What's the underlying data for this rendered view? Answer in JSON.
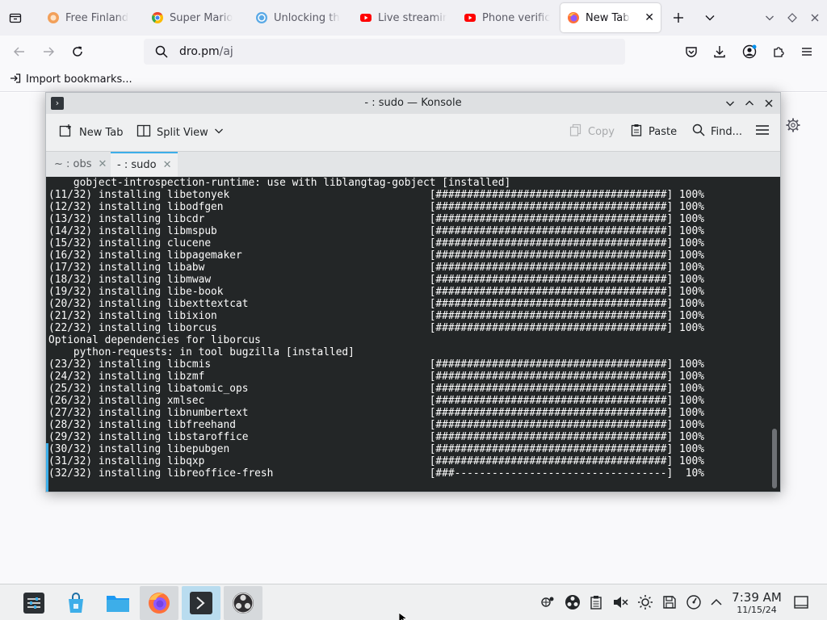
{
  "browser": {
    "tabs": [
      {
        "label": "Free Finland",
        "favicon": "globe-orange-icon",
        "color": "#f2a05a"
      },
      {
        "label": "Super Mario",
        "favicon": "chrome-like-icon",
        "color": "#ea4335"
      },
      {
        "label": "Unlocking th",
        "favicon": "blue-circle-icon",
        "color": "#5aa9e6"
      },
      {
        "label": "Live streamir",
        "favicon": "youtube-icon",
        "color": "#ff0000"
      },
      {
        "label": "Phone verific",
        "favicon": "youtube-icon",
        "color": "#ff0000"
      },
      {
        "label": "New Tab",
        "favicon": "firefox-icon",
        "color": "#ff7139",
        "active": true
      }
    ],
    "url": {
      "host": "dro.pm",
      "path": "/aj"
    },
    "bookmarks_bar": {
      "import_label": "Import bookmarks..."
    }
  },
  "konsole": {
    "title": "- : sudo — Konsole",
    "toolbar": {
      "new_tab": "New Tab",
      "split_view": "Split View",
      "copy": "Copy",
      "paste": "Paste",
      "find": "Find..."
    },
    "tabs": [
      {
        "label": "~ : obs",
        "active": false
      },
      {
        "label": "- : sudo",
        "active": true
      }
    ],
    "terminal_lines": [
      "    gobject-introspection-runtime: use with liblangtag-gobject [installed]",
      "(11/32) installing libetonyek                                [#####################################] 100%",
      "(12/32) installing libodfgen                                 [#####################################] 100%",
      "(13/32) installing libcdr                                    [#####################################] 100%",
      "(14/32) installing libmspub                                  [#####################################] 100%",
      "(15/32) installing clucene                                   [#####################################] 100%",
      "(16/32) installing libpagemaker                              [#####################################] 100%",
      "(17/32) installing libabw                                    [#####################################] 100%",
      "(18/32) installing libmwaw                                   [#####################################] 100%",
      "(19/32) installing libe-book                                 [#####################################] 100%",
      "(20/32) installing libexttextcat                             [#####################################] 100%",
      "(21/32) installing libixion                                  [#####################################] 100%",
      "(22/32) installing liborcus                                  [#####################################] 100%",
      "Optional dependencies for liborcus",
      "    python-requests: in tool bugzilla [installed]",
      "(23/32) installing libcmis                                   [#####################################] 100%",
      "(24/32) installing libzmf                                    [#####################################] 100%",
      "(25/32) installing libatomic_ops                             [#####################################] 100%",
      "(26/32) installing xmlsec                                    [#####################################] 100%",
      "(27/32) installing libnumbertext                             [#####################################] 100%",
      "(28/32) installing libfreehand                               [#####################################] 100%",
      "(29/32) installing libstaroffice                             [#####################################] 100%",
      "(30/32) installing libepubgen                                [#####################################] 100%",
      "(31/32) installing libqxp                                    [#####################################] 100%",
      "(32/32) installing libreoffice-fresh                         [###----------------------------------]  10%"
    ]
  },
  "taskbar": {
    "apps": [
      {
        "name": "application-launcher-icon",
        "state": "normal"
      },
      {
        "name": "discover-store-icon",
        "state": "normal"
      },
      {
        "name": "file-manager-icon",
        "state": "normal"
      },
      {
        "name": "firefox-icon",
        "state": "running"
      },
      {
        "name": "konsole-icon",
        "state": "active"
      },
      {
        "name": "obs-studio-icon",
        "state": "running"
      }
    ],
    "clock": {
      "time": "7:39 AM",
      "date": "11/15/24"
    }
  },
  "colors": {
    "accent": "#3daee9",
    "terminal_bg": "#232627",
    "terminal_fg": "#fcfcfc"
  }
}
